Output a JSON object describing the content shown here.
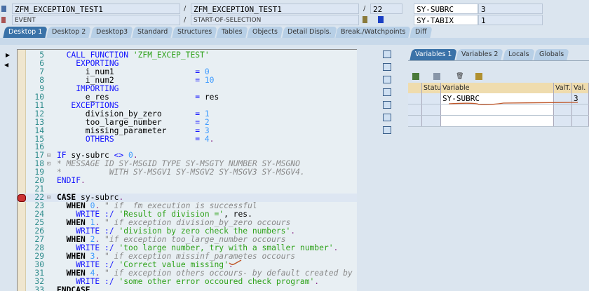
{
  "header": {
    "program": "ZFM_EXCEPTION_TEST1",
    "include": "ZFM_EXCEPTION_TEST1",
    "line": "22",
    "event_type": "EVENT",
    "event": "START-OF-SELECTION",
    "sys_fields": [
      {
        "name": "SY-SUBRC",
        "value": "3"
      },
      {
        "name": "SY-TABIX",
        "value": "1"
      }
    ],
    "separator": "/"
  },
  "tabs": [
    "Desktop 1",
    "Desktop 2",
    "Desktop3",
    "Standard",
    "Structures",
    "Tables",
    "Objects",
    "Detail Displs.",
    "Break./Watchpoints",
    "Diff"
  ],
  "active_tab": 0,
  "code": [
    {
      "n": "5",
      "t": [
        [
          "  ",
          "pl"
        ],
        [
          "CALL FUNCTION ",
          "kw"
        ],
        [
          "'ZFM_EXCEP_TEST'",
          "str"
        ]
      ]
    },
    {
      "n": "6",
      "t": [
        [
          "    ",
          "pl"
        ],
        [
          "EXPORTING",
          "kw"
        ]
      ]
    },
    {
      "n": "7",
      "t": [
        [
          "      i_num1                 ",
          "pl"
        ],
        [
          "= ",
          "kw"
        ],
        [
          "0",
          "num"
        ]
      ]
    },
    {
      "n": "8",
      "t": [
        [
          "      i_num2                 ",
          "pl"
        ],
        [
          "= ",
          "kw"
        ],
        [
          "10",
          "num"
        ]
      ]
    },
    {
      "n": "9",
      "t": [
        [
          "    ",
          "pl"
        ],
        [
          "IMPORTING",
          "kw"
        ]
      ]
    },
    {
      "n": "10",
      "t": [
        [
          "      e_res                  ",
          "pl"
        ],
        [
          "= ",
          "kw"
        ],
        [
          "res",
          "pl"
        ]
      ]
    },
    {
      "n": "11",
      "t": [
        [
          "   ",
          "pl"
        ],
        [
          "EXCEPTIONS",
          "kw"
        ]
      ]
    },
    {
      "n": "12",
      "t": [
        [
          "      division_by_zero       ",
          "pl"
        ],
        [
          "= ",
          "kw"
        ],
        [
          "1",
          "num"
        ]
      ]
    },
    {
      "n": "13",
      "t": [
        [
          "      too_large_number       ",
          "pl"
        ],
        [
          "= ",
          "kw"
        ],
        [
          "2",
          "num"
        ]
      ]
    },
    {
      "n": "14",
      "t": [
        [
          "      missing_parameter      ",
          "pl"
        ],
        [
          "= ",
          "kw"
        ],
        [
          "3",
          "num"
        ]
      ]
    },
    {
      "n": "15",
      "t": [
        [
          "      ",
          "pl"
        ],
        [
          "OTHERS",
          "kw"
        ],
        [
          "                 ",
          "pl"
        ],
        [
          "= ",
          "kw"
        ],
        [
          "4",
          "num"
        ],
        [
          ".",
          "pu"
        ]
      ]
    },
    {
      "n": "16",
      "t": []
    },
    {
      "n": "17",
      "t": [
        [
          "IF ",
          "kw"
        ],
        [
          "sy-subrc ",
          "pl"
        ],
        [
          "<> ",
          "kw"
        ],
        [
          "0",
          "num"
        ],
        [
          ".",
          "pu"
        ]
      ],
      "fold": "⊟"
    },
    {
      "n": "18",
      "t": [
        [
          "* MESSAGE ID SY-MSGID TYPE SY-MSGTY NUMBER SY-MSGNO",
          "cm"
        ]
      ],
      "fold": "⊡"
    },
    {
      "n": "19",
      "t": [
        [
          "*          WITH SY-MSGV1 SY-MSGV2 SY-MSGV3 SY-MSGV4.",
          "cm"
        ]
      ]
    },
    {
      "n": "20",
      "t": [
        [
          "ENDIF",
          "kw"
        ],
        [
          ".",
          "pu"
        ]
      ]
    },
    {
      "n": "21",
      "t": []
    },
    {
      "n": "22",
      "t": [
        [
          "CASE ",
          "bk"
        ],
        [
          "sy-subrc",
          "pl"
        ],
        [
          ".",
          "pu"
        ]
      ],
      "fold": "⊟",
      "current": true,
      "breakpoint": true
    },
    {
      "n": "23",
      "t": [
        [
          "  ",
          "pl"
        ],
        [
          "WHEN ",
          "bk"
        ],
        [
          "0",
          "num"
        ],
        [
          ". ",
          "pu"
        ],
        [
          "\" if  fm execution is successful",
          "cm"
        ]
      ]
    },
    {
      "n": "24",
      "t": [
        [
          "    ",
          "pl"
        ],
        [
          "WRITE ",
          "kw"
        ],
        [
          ":/ ",
          "kw"
        ],
        [
          "'Result of division ='",
          "str"
        ],
        [
          ", res.",
          "pl"
        ]
      ]
    },
    {
      "n": "25",
      "t": [
        [
          "  ",
          "pl"
        ],
        [
          "WHEN ",
          "bk"
        ],
        [
          "1",
          "num"
        ],
        [
          ". ",
          "pu"
        ],
        [
          "\" if exception division_by_zero occours",
          "cm"
        ]
      ]
    },
    {
      "n": "26",
      "t": [
        [
          "    ",
          "pl"
        ],
        [
          "WRITE ",
          "kw"
        ],
        [
          ":/ ",
          "kw"
        ],
        [
          "'division by zero check the numbers'",
          "str"
        ],
        [
          ".",
          "pu"
        ]
      ]
    },
    {
      "n": "27",
      "t": [
        [
          "  ",
          "pl"
        ],
        [
          "WHEN ",
          "bk"
        ],
        [
          "2",
          "num"
        ],
        [
          ". ",
          "pu"
        ],
        [
          "\"if exception too_large_number occours",
          "cm"
        ]
      ]
    },
    {
      "n": "28",
      "t": [
        [
          "    ",
          "pl"
        ],
        [
          "WRITE ",
          "kw"
        ],
        [
          ":/ ",
          "kw"
        ],
        [
          "'too large number, try with a smaller number'",
          "str"
        ],
        [
          ".",
          "pu"
        ]
      ]
    },
    {
      "n": "29",
      "t": [
        [
          "  ",
          "pl"
        ],
        [
          "WHEN ",
          "bk"
        ],
        [
          "3",
          "num"
        ],
        [
          ". ",
          "pu"
        ],
        [
          "\" if exception missinf_parametes occours",
          "cm"
        ]
      ]
    },
    {
      "n": "30",
      "t": [
        [
          "    ",
          "pl"
        ],
        [
          "WRITE ",
          "kw"
        ],
        [
          ":/ ",
          "kw"
        ],
        [
          "'Correct value missing'",
          "str"
        ],
        [
          ".",
          "pu"
        ]
      ]
    },
    {
      "n": "31",
      "t": [
        [
          "  ",
          "pl"
        ],
        [
          "WHEN ",
          "bk"
        ],
        [
          "4",
          "num"
        ],
        [
          ". ",
          "pu"
        ],
        [
          "\" if exception others occours- by default created by n",
          "cm"
        ]
      ]
    },
    {
      "n": "32",
      "t": [
        [
          "    ",
          "pl"
        ],
        [
          "WRITE ",
          "kw"
        ],
        [
          ":/ ",
          "kw"
        ],
        [
          "'some other error occoured check program'",
          "str"
        ],
        [
          ".",
          "pu"
        ]
      ]
    },
    {
      "n": "33",
      "t": [
        [
          "ENDCASE",
          "bk"
        ],
        [
          ".",
          "pu"
        ]
      ]
    }
  ],
  "var_panel": {
    "tabs": [
      "Variables 1",
      "Variables 2",
      "Locals",
      "Globals"
    ],
    "columns": [
      "Status",
      "Variable",
      "ValT...",
      "Val."
    ],
    "rows": [
      {
        "status": "",
        "variable": "SY-SUBRC",
        "valtype": "",
        "value": "3"
      },
      {
        "status": "",
        "variable": "",
        "valtype": "",
        "value": ""
      },
      {
        "status": "",
        "variable": "",
        "valtype": "",
        "value": ""
      }
    ]
  },
  "colors": {
    "active_tab": "#3a72a8",
    "annotation": "#c0582a"
  }
}
